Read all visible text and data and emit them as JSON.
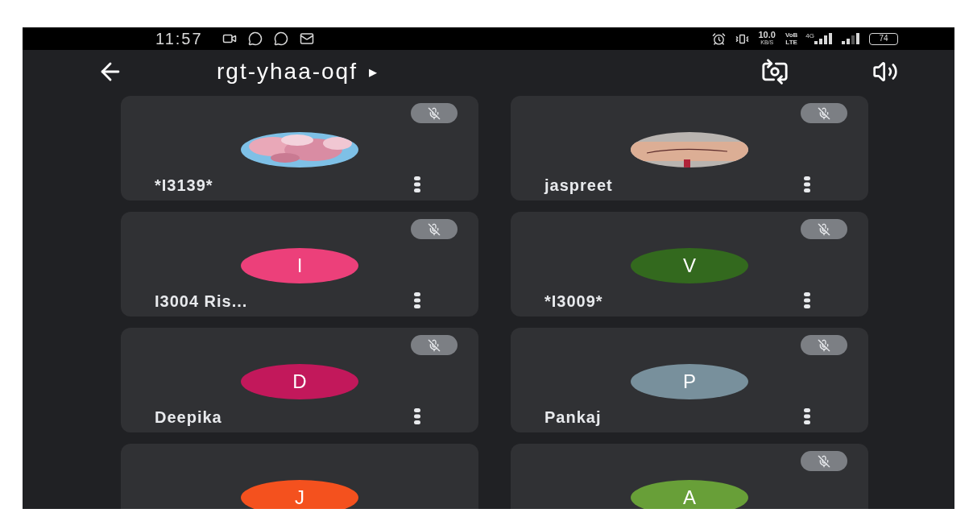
{
  "status_bar": {
    "time": "11:57",
    "speed_value": "10.0",
    "speed_unit": "KB/S",
    "volte_top": "VoB",
    "volte_bottom": "LTE",
    "network": "4G",
    "battery": "74"
  },
  "header": {
    "meeting_code": "rgt-yhaa-oqf",
    "expand_glyph": "▸"
  },
  "tiles": [
    {
      "name": "*I3139*",
      "muted": true
    },
    {
      "name": "jaspreet",
      "muted": true
    },
    {
      "name": "I3004 Ris...",
      "muted": true,
      "avatar": {
        "kind": "initial",
        "letter": "I",
        "color": "#ec407a"
      }
    },
    {
      "name": "*I3009*",
      "muted": true,
      "avatar": {
        "kind": "initial",
        "letter": "V",
        "color": "#33691e"
      }
    },
    {
      "name": "Deepika",
      "muted": true,
      "avatar": {
        "kind": "initial",
        "letter": "D",
        "color": "#c2185b"
      }
    },
    {
      "name": "Pankaj",
      "muted": true,
      "avatar": {
        "kind": "initial",
        "letter": "P",
        "color": "#78909c"
      }
    },
    {
      "muted": false,
      "avatar": {
        "kind": "initial",
        "letter": "J",
        "color": "#f4511e"
      }
    },
    {
      "muted": true,
      "avatar": {
        "kind": "initial",
        "letter": "A",
        "color": "#689f38"
      }
    }
  ]
}
